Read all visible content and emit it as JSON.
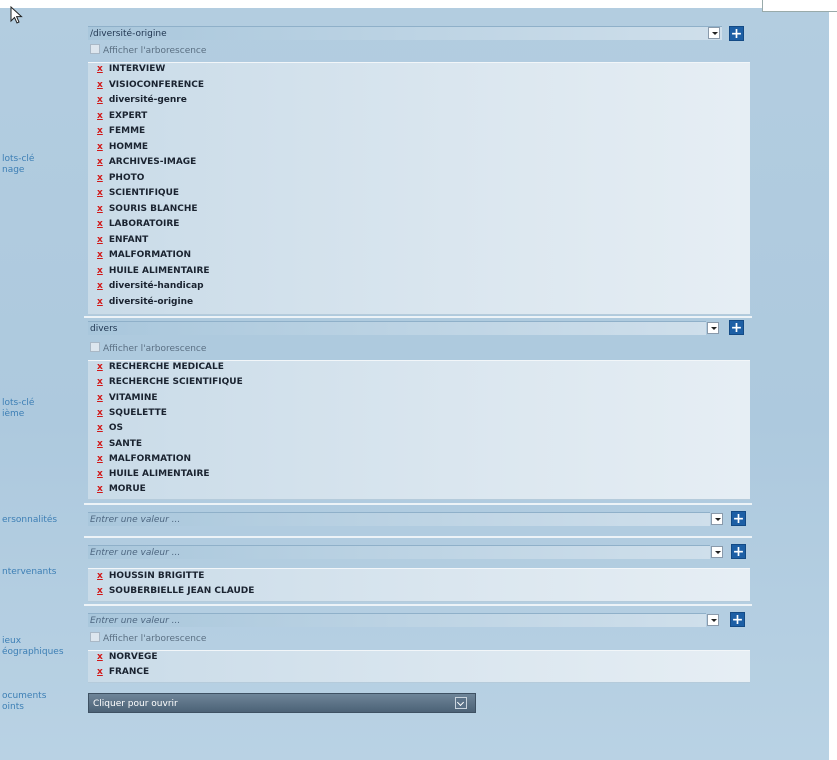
{
  "labels": {
    "mots_cle_image": [
      "lots-clé",
      "nage"
    ],
    "mots_cle_theme": [
      "lots-clé",
      "ième"
    ],
    "personnalites": "ersonnalités",
    "intervenants": "ntervenants",
    "lieux": [
      "ieux",
      "éographiques"
    ],
    "documents": [
      "ocuments",
      "oints"
    ]
  },
  "combos": {
    "image": "/diversité-origine",
    "theme": "divers",
    "personnalites": "Entrer une valeur ...",
    "intervenants": "Entrer une valeur ...",
    "lieux": "Entrer une valeur ..."
  },
  "tree_label": "Afficher l'arborescence",
  "delete_glyph": "x",
  "image_keywords": [
    "INTERVIEW",
    "VISIOCONFERENCE",
    "diversité-genre",
    "EXPERT",
    "FEMME",
    "HOMME",
    "ARCHIVES-IMAGE",
    "PHOTO",
    "SCIENTIFIQUE",
    "SOURIS BLANCHE",
    "LABORATOIRE",
    "ENFANT",
    "MALFORMATION",
    "HUILE ALIMENTAIRE",
    "diversité-handicap",
    "diversité-origine"
  ],
  "theme_keywords": [
    "RECHERCHE MEDICALE",
    "RECHERCHE SCIENTIFIQUE",
    "VITAMINE",
    "SQUELETTE",
    "OS",
    "SANTE",
    "MALFORMATION",
    "HUILE ALIMENTAIRE",
    "MORUE"
  ],
  "intervenants_list": [
    "HOUSSIN BRIGITTE",
    "SOUBERBIELLE JEAN CLAUDE"
  ],
  "lieux_list": [
    "NORVEGE",
    "FRANCE"
  ],
  "documents_button": "Cliquer pour ouvrir",
  "colors": {
    "accent": "#1d5fa5",
    "delete": "#d11818",
    "label": "#3d7fb5"
  }
}
